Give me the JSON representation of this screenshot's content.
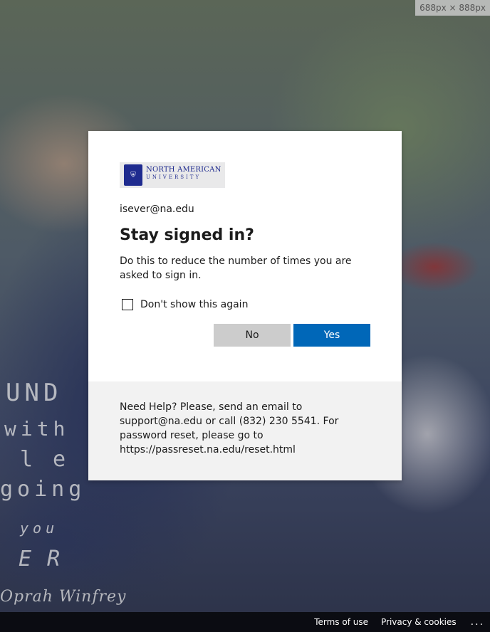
{
  "dimension_label": "688px × 888px",
  "background_quote_lines": [
    "UND",
    "with",
    "le",
    "going",
    "you",
    "ER",
    "Oprah Winfrey"
  ],
  "logo": {
    "line1": "NORTH AMERICAN",
    "line2": "UNIVERSITY",
    "emblem_icon": "shield-emblem-icon"
  },
  "signin": {
    "identity": "isever@na.edu",
    "title": "Stay signed in?",
    "description": "Do this to reduce the number of times you are asked to sign in.",
    "checkbox_label": "Don't show this again",
    "checkbox_checked": false,
    "no_label": "No",
    "yes_label": "Yes"
  },
  "help_text": "Need Help? Please, send an email to support@na.edu or call (832) 230 5541. For password reset, please go to https://passreset.na.edu/reset.html",
  "footer": {
    "terms": "Terms of use",
    "privacy": "Privacy & cookies",
    "more": "..."
  },
  "colors": {
    "primary_button": "#0067b8",
    "secondary_button": "#cccccc",
    "help_background": "#f2f2f2"
  }
}
